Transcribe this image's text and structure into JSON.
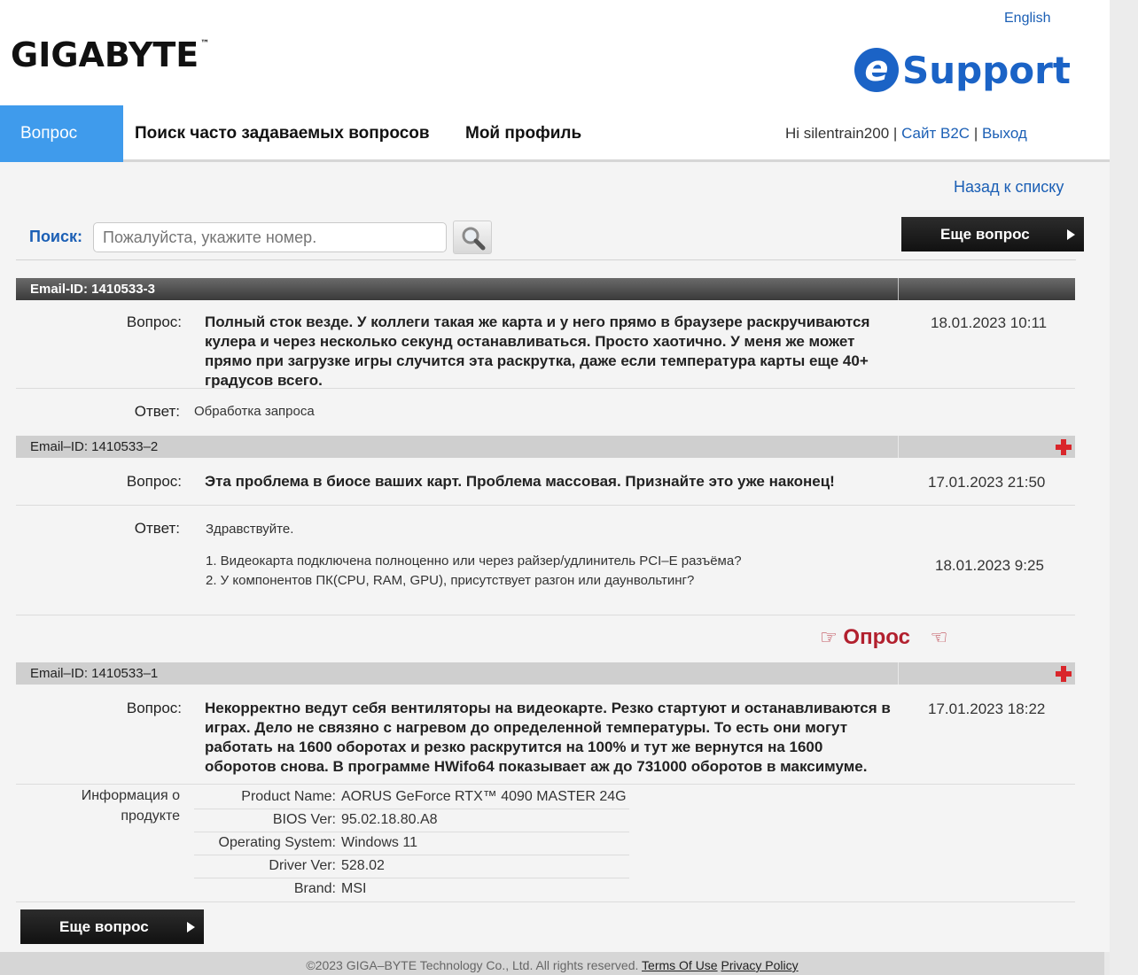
{
  "header": {
    "logo_text": "GIGABYTE",
    "logo_tm": "™",
    "lang": "English",
    "esupport_e": "e",
    "esupport_word": "Support"
  },
  "nav": {
    "tabs": [
      {
        "label": "Вопрос",
        "active": true
      },
      {
        "label": "Поиск часто задаваемых вопросов",
        "active": false
      },
      {
        "label": "Мой профиль",
        "active": false
      }
    ],
    "greeting": "Hi silentrain200",
    "sep": "|",
    "b2c_link": "Сайт B2C",
    "logout_link": "Выход"
  },
  "back_link": "Назад к списку",
  "search": {
    "label": "Поиск:",
    "placeholder": "Пожалуйста, укажите номер.",
    "more_button": "Еще вопрос"
  },
  "tickets": [
    {
      "email_id": "Email-ID: 1410533-3",
      "question_label": "Вопрос:",
      "question": "Полный сток везде. У коллеги такая же карта и у него прямо в браузере раскручиваются кулера и через несколько секунд останавливаться. Просто хаотично. У меня же может прямо при загрузке игры случится эта раскрутка, даже если температура карты еще 40+ градусов всего.",
      "question_date": "18.01.2023 10:11",
      "answer_label": "Ответ:",
      "answer": "Обработка запроса"
    },
    {
      "email_id": "Email–ID: 1410533–2",
      "question_label": "Вопрос:",
      "question": "Эта проблема в биосе ваших карт. Проблема массовая. Признайте это уже наконец!",
      "question_date": "17.01.2023 21:50",
      "answer_label": "Ответ:",
      "answer_lines": [
        "Здравствуйте.",
        "1. Видеокарта подключена полноценно или через райзер/удлинитель PCI–E разъёма?",
        "2. У компонентов ПК(CPU, RAM, GPU), присутствует разгон или даунвольтинг?"
      ],
      "answer_date": "18.01.2023 9:25"
    },
    {
      "email_id": "Email–ID: 1410533–1",
      "question_label": "Вопрос:",
      "question": "Некорректно ведут себя вентиляторы на видеокарте. Резко стартуют и останавливаются в играх. Дело не связяно с нагревом до определенной температуры. То есть они могут работать на 1600 оборотах и резко раскрутится на 100% и тут же вернутся на 1600 оборотов снова. В программе HWifo64 показывает аж до 731000 оборотов в максимуме.",
      "question_date": "17.01.2023 18:22",
      "product_label_1": "Информация о",
      "product_label_2": "продукте",
      "product_info": [
        {
          "label": "Product Name:",
          "value": "AORUS GeForce RTX™ 4090 MASTER 24G"
        },
        {
          "label": "BIOS Ver:",
          "value": "95.02.18.80.A8"
        },
        {
          "label": "Operating System:",
          "value": "Windows 11"
        },
        {
          "label": "Driver Ver:",
          "value": "528.02"
        },
        {
          "label": "Brand:",
          "value": "MSI"
        }
      ]
    }
  ],
  "poll": {
    "label": "Опрос",
    "left_icon": "☞",
    "right_icon": "☜"
  },
  "bottom_more_button": "Еще вопрос",
  "footer": {
    "copyright": "©2023 GIGA–BYTE Technology Co., Ltd. All rights reserved.",
    "terms": "Terms Of Use",
    "privacy": "Privacy Policy"
  },
  "colors": {
    "accent": "#3f9bec",
    "link": "#1b5fb5",
    "brand_blue": "#1b63c6",
    "poll_red": "#b2202e",
    "plus_red": "#d9262b"
  }
}
